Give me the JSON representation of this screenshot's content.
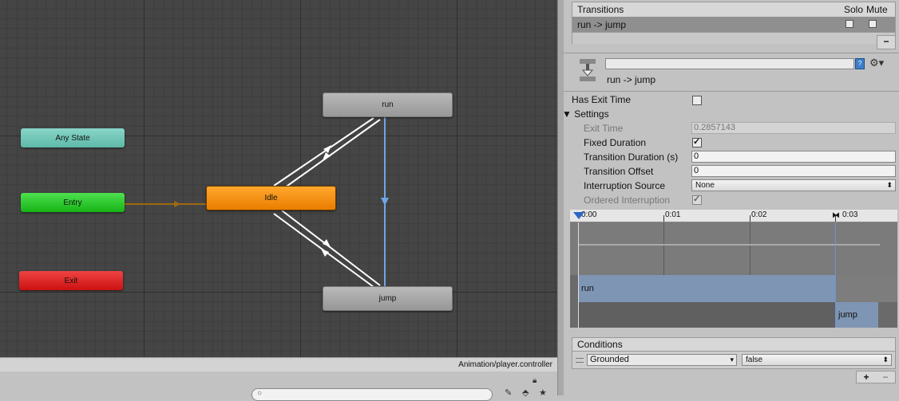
{
  "graph": {
    "nodes": {
      "any_state": "Any State",
      "entry": "Entry",
      "exit": "Exit",
      "idle": "Idle",
      "run": "run",
      "jump": "jump"
    },
    "colors": {
      "any_state": "#6ec6b8",
      "entry": "#2ccc2c",
      "exit": "#dd2222",
      "default_state": "#f59a16",
      "state": "#a8a8a8",
      "selected_transition": "#6ea6e6"
    },
    "path": "Animation/player.controller"
  },
  "transitions": {
    "header": "Transitions",
    "solo_label": "Solo",
    "mute_label": "Mute",
    "items": [
      {
        "label": "run -> jump",
        "solo": false,
        "mute": false
      }
    ]
  },
  "inspector": {
    "name_value": "",
    "title": "run -> jump",
    "has_exit_time_label": "Has Exit Time",
    "has_exit_time": false,
    "settings_label": "Settings",
    "exit_time_label": "Exit Time",
    "exit_time": "0.2857143",
    "fixed_duration_label": "Fixed Duration",
    "fixed_duration": true,
    "transition_duration_label": "Transition Duration (s)",
    "transition_duration": "0",
    "transition_offset_label": "Transition Offset",
    "transition_offset": "0",
    "interruption_source_label": "Interruption Source",
    "interruption_source": "None",
    "ordered_interruption_label": "Ordered Interruption",
    "ordered_interruption": true
  },
  "timeline": {
    "ticks": [
      "0:00",
      "0:01",
      "0:02",
      "0:03"
    ],
    "tracks": {
      "source": "run",
      "destination": "jump"
    }
  },
  "conditions": {
    "header": "Conditions",
    "items": [
      {
        "parameter": "Grounded",
        "value": "false"
      }
    ]
  }
}
